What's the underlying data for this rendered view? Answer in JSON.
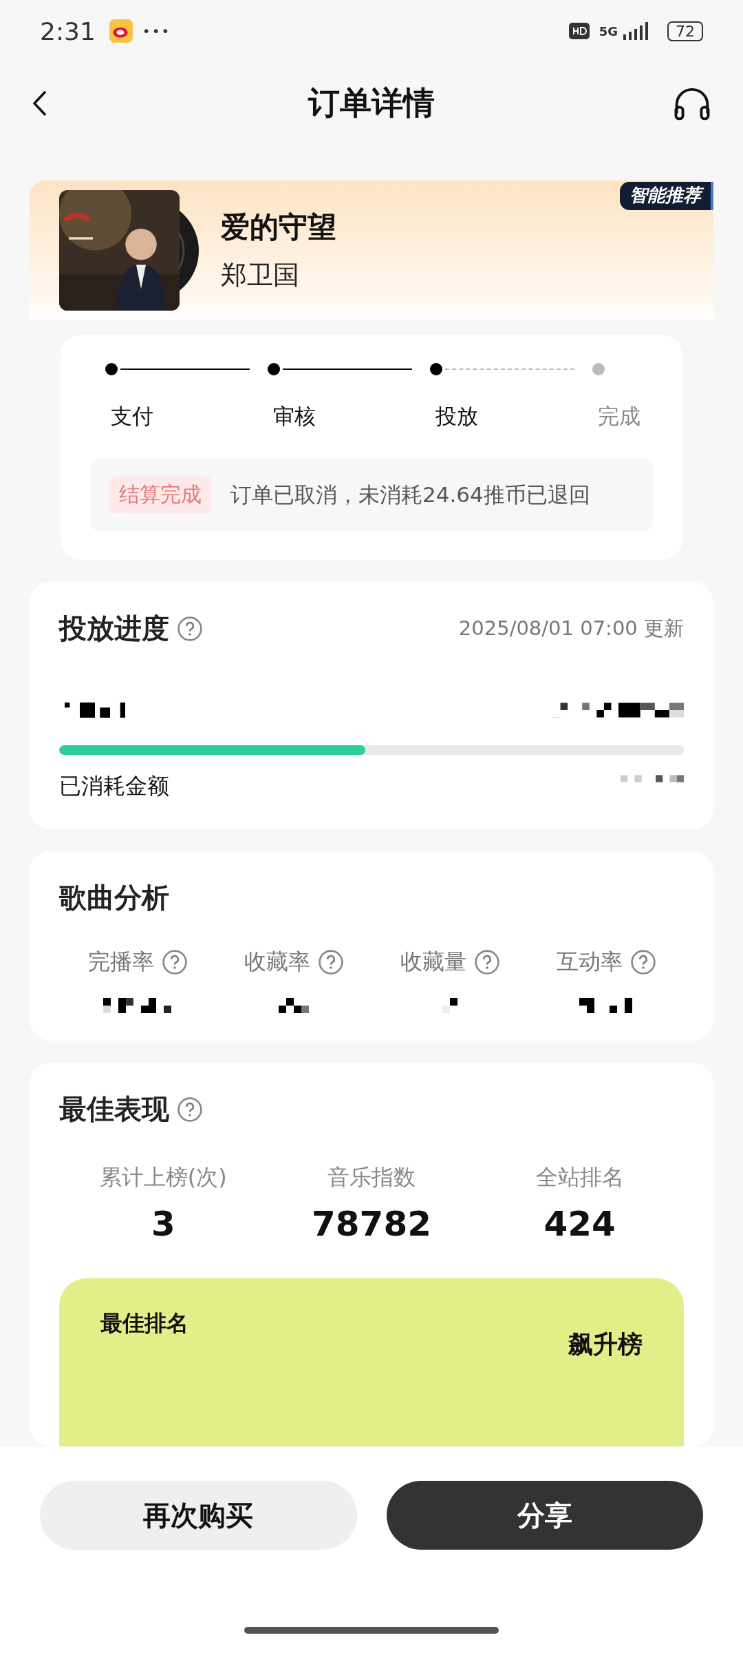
{
  "status_bar": {
    "time": "2:31",
    "more": "•••",
    "network": "5G",
    "battery": "72"
  },
  "header": {
    "title": "订单详情"
  },
  "song": {
    "badge": "智能推荐",
    "title": "爱的守望",
    "artist": "郑卫国"
  },
  "steps": [
    {
      "label": "支付",
      "done": true
    },
    {
      "label": "审核",
      "done": true
    },
    {
      "label": "投放",
      "done": true
    },
    {
      "label": "完成",
      "done": false
    }
  ],
  "notice": {
    "tag": "结算完成",
    "text": "订单已取消，未消耗24.64推币已退回"
  },
  "delivery": {
    "title": "投放进度",
    "updated": "2025/08/01 07:00 更新",
    "level": 0.49,
    "spent_label": "已消耗金额"
  },
  "analysis": {
    "title": "歌曲分析",
    "metrics": [
      {
        "label": "完播率"
      },
      {
        "label": "收藏率"
      },
      {
        "label": "收藏量"
      },
      {
        "label": "互动率"
      }
    ]
  },
  "best": {
    "title": "最佳表现",
    "stats": [
      {
        "label": "累计上榜(次)",
        "value": "3"
      },
      {
        "label": "音乐指数",
        "value": "78782"
      },
      {
        "label": "全站排名",
        "value": "424"
      }
    ],
    "rank_label": "最佳排名",
    "rank_chart": "飙升榜"
  },
  "buttons": [
    {
      "label": "再次购买",
      "kind": "secondary"
    },
    {
      "label": "分享",
      "kind": "primary"
    }
  ]
}
